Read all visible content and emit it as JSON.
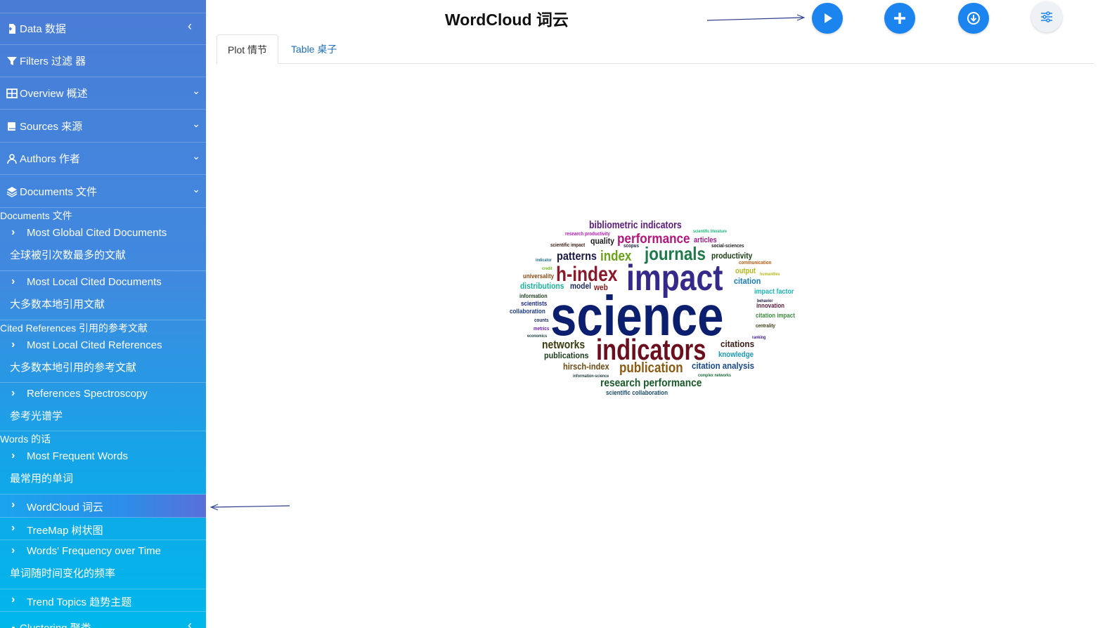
{
  "sidebar": {
    "top_partial_label": "",
    "items": [
      {
        "label": "Data 数据"
      },
      {
        "label": "Filters 过滤 器"
      },
      {
        "label": "Overview 概述"
      },
      {
        "label": "Sources 来源"
      },
      {
        "label": "Authors 作者"
      },
      {
        "label": "Documents 文件"
      }
    ],
    "sections": {
      "documents": "Documents  文件",
      "cited_refs": "Cited References  引用的参考文献",
      "words": "Words  的话"
    },
    "sub_items": [
      {
        "en": "Most Global Cited Documents",
        "zh": "全球被引次数最多的文献"
      },
      {
        "en": "Most Local Cited Documents",
        "zh": "大多数本地引用文献"
      },
      {
        "en": "Most Local Cited References",
        "zh": "大多数本地引用的参考文献"
      },
      {
        "en": "References Spectroscopy",
        "zh": "参考光谱学"
      },
      {
        "en": "Most Frequent Words",
        "zh": "最常用的单词"
      },
      {
        "en": "WordCloud  词云"
      },
      {
        "en": "TreeMap  树状图"
      },
      {
        "en": "Words' Frequency over Time",
        "zh": "单词随时间变化的频率"
      },
      {
        "en": "Trend Topics  趋势主题"
      }
    ],
    "bottom_partial_label": "Clustering 聚类"
  },
  "header": {
    "title": "WordCloud 词云",
    "buttons": [
      "play-icon",
      "plus-icon",
      "download-icon",
      "sliders-icon"
    ],
    "accent": "#1b84ef"
  },
  "tabs": [
    {
      "label": "Plot 情节"
    },
    {
      "label": "Table 桌子"
    }
  ],
  "wordcloud": {
    "words": [
      {
        "text": "science",
        "color": "#0b1f6e"
      },
      {
        "text": "impact",
        "color": "#352a8a"
      },
      {
        "text": "indicators",
        "color": "#6b0f1f"
      },
      {
        "text": "h-index",
        "color": "#8a1a2a"
      },
      {
        "text": "journals",
        "color": "#1f7a4a"
      },
      {
        "text": "performance",
        "color": "#b3157a"
      },
      {
        "text": "index",
        "color": "#6aa21a"
      },
      {
        "text": "patterns",
        "color": "#1a1a4a"
      },
      {
        "text": "bibliometric indicators",
        "color": "#5a1a7a"
      },
      {
        "text": "publication",
        "color": "#8a5a12"
      },
      {
        "text": "research performance",
        "color": "#1a5a2a"
      },
      {
        "text": "networks",
        "color": "#3a3a12"
      },
      {
        "text": "citations",
        "color": "#3a1a12"
      },
      {
        "text": "citation analysis",
        "color": "#1a4a8a"
      },
      {
        "text": "hirsch-index",
        "color": "#6a4a12"
      },
      {
        "text": "publications",
        "color": "#1a3a1a"
      },
      {
        "text": "productivity",
        "color": "#1a3a12"
      },
      {
        "text": "citation",
        "color": "#1a7ab5"
      },
      {
        "text": "quality",
        "color": "#1a1a1a"
      },
      {
        "text": "articles",
        "color": "#9a1a8a"
      },
      {
        "text": "distributions",
        "color": "#1ab59a"
      },
      {
        "text": "model",
        "color": "#1a2a5a"
      },
      {
        "text": "web",
        "color": "#8a1a1a"
      },
      {
        "text": "knowledge",
        "color": "#1a9ab5"
      },
      {
        "text": "output",
        "color": "#b5b51a"
      },
      {
        "text": "impact factor",
        "color": "#1ab5b5"
      },
      {
        "text": "innovation",
        "color": "#5a1a3a"
      },
      {
        "text": "citation impact",
        "color": "#3a8a3a"
      },
      {
        "text": "scientists",
        "color": "#1a2a8a"
      },
      {
        "text": "collaboration",
        "color": "#1a3a8a"
      },
      {
        "text": "information",
        "color": "#1a3a1a"
      },
      {
        "text": "universality",
        "color": "#8a4a12"
      },
      {
        "text": "scientific collaboration",
        "color": "#1a4a6a"
      },
      {
        "text": "research productivity",
        "color": "#b51ab5"
      },
      {
        "text": "scientific impact",
        "color": "#3a1a12"
      },
      {
        "text": "scopus",
        "color": "#1a1a3a"
      },
      {
        "text": "social-sciences",
        "color": "#1a1a1a"
      },
      {
        "text": "scientific literature",
        "color": "#1ab57a"
      },
      {
        "text": "communication",
        "color": "#b55a12"
      },
      {
        "text": "humanities",
        "color": "#b5b51a"
      },
      {
        "text": "indicator",
        "color": "#1a6a8a"
      },
      {
        "text": "credit",
        "color": "#6ab51a"
      },
      {
        "text": "behavior",
        "color": "#1a1a3a"
      },
      {
        "text": "counts",
        "color": "#1a2a5a"
      },
      {
        "text": "metrics",
        "color": "#6a1ab5"
      },
      {
        "text": "economics",
        "color": "#1a3a3a"
      },
      {
        "text": "centrality",
        "color": "#3a3a12"
      },
      {
        "text": "ranking",
        "color": "#3a1a8a"
      },
      {
        "text": "information-science",
        "color": "#1a3a3a"
      },
      {
        "text": "complex networks",
        "color": "#1a6a3a"
      }
    ]
  }
}
